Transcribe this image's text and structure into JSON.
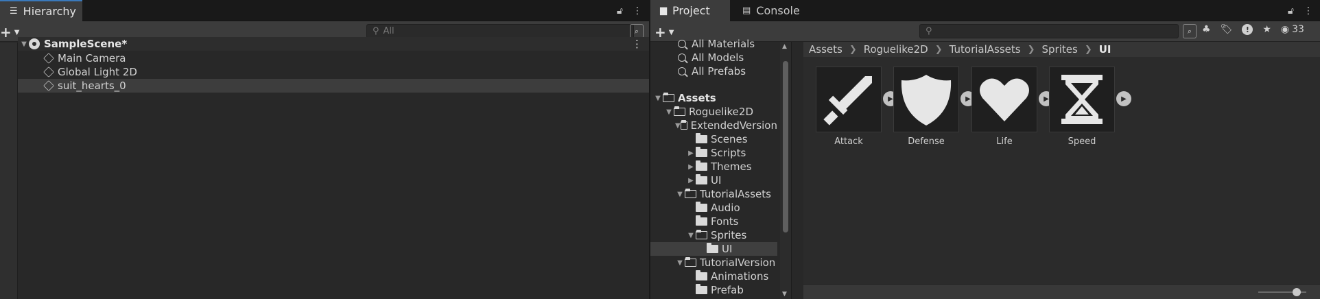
{
  "hierarchy": {
    "tab_label": "Hierarchy",
    "search_placeholder": "All",
    "scene_name": "SampleScene*",
    "items": [
      "Main Camera",
      "Global Light 2D",
      "suit_hearts_0"
    ]
  },
  "project": {
    "tabs": [
      "Project",
      "Console"
    ],
    "badge_count": "33",
    "favorites": [
      "All Materials",
      "All Models",
      "All Prefabs"
    ],
    "tree": {
      "assets": "Assets",
      "roguelike": "Roguelike2D",
      "extended": "ExtendedVersion",
      "scenes": "Scenes",
      "scripts": "Scripts",
      "themes": "Themes",
      "ui1": "UI",
      "tutorialassets": "TutorialAssets",
      "audio": "Audio",
      "fonts": "Fonts",
      "sprites": "Sprites",
      "ui2": "UI",
      "tutorialversion": "TutorialVersion",
      "animations": "Animations",
      "prefab": "Prefab"
    },
    "breadcrumb": [
      "Assets",
      "Roguelike2D",
      "TutorialAssets",
      "Sprites",
      "UI"
    ],
    "assets": [
      {
        "name": "Attack",
        "icon": "sword-icon"
      },
      {
        "name": "Defense",
        "icon": "shield-icon"
      },
      {
        "name": "Life",
        "icon": "heart-icon"
      },
      {
        "name": "Speed",
        "icon": "hourglass-icon"
      }
    ],
    "zoom_level": 0.8
  }
}
